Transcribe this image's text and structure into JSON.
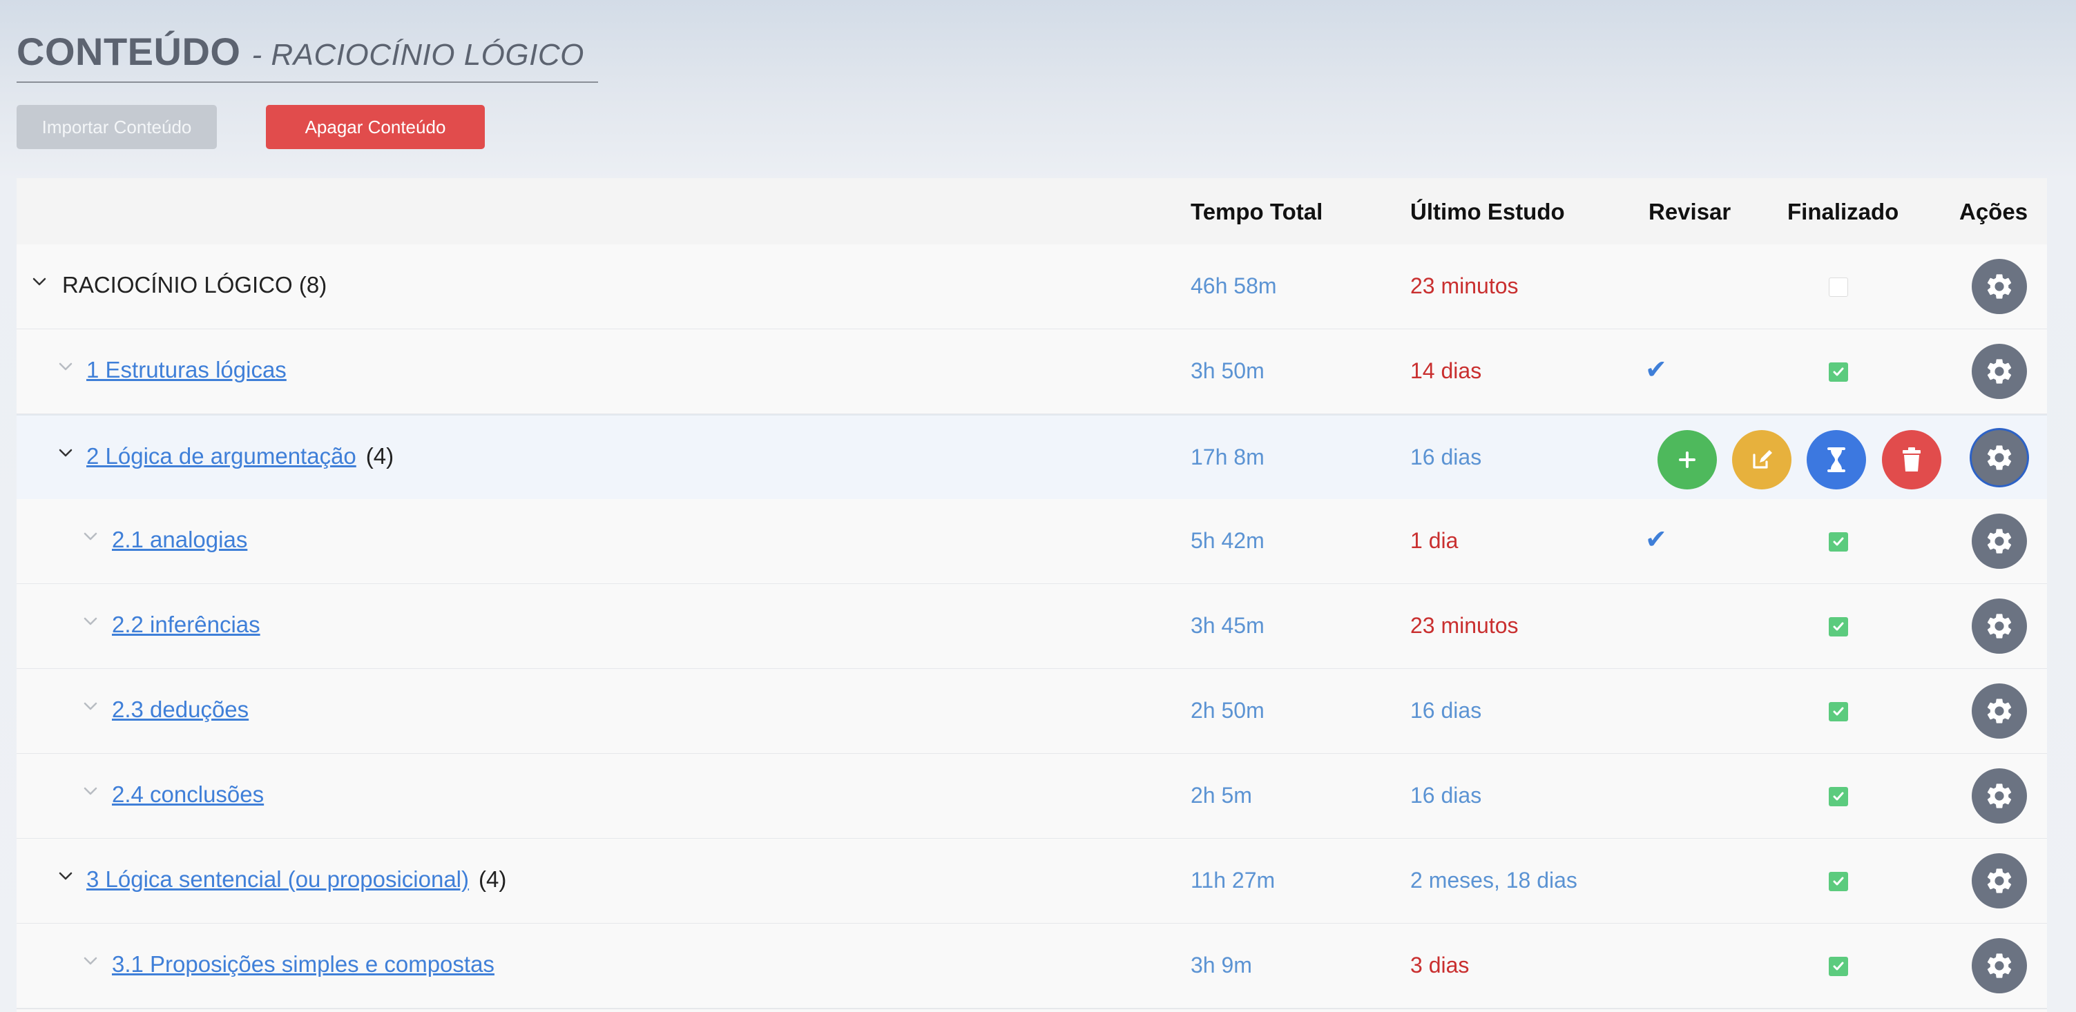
{
  "header": {
    "title": "CONTEÚDO",
    "subtitle": "- RACIOCÍNIO LÓGICO"
  },
  "buttons": {
    "import_label": "Importar Conteúdo",
    "delete_label": "Apagar Conteúdo"
  },
  "table": {
    "columns": {
      "total_time": "Tempo Total",
      "last_study": "Último Estudo",
      "review": "Revisar",
      "finished": "Finalizado",
      "actions": "Ações"
    },
    "rows": [
      {
        "name": "RACIOCÍNIO LÓGICO (8)",
        "count": "",
        "total": "46h 58m",
        "last": "23 minutos",
        "last_color": "red",
        "review": "",
        "finished": false
      },
      {
        "name": "1 Estruturas lógicas",
        "count": "",
        "total": "3h 50m",
        "last": "14 dias",
        "last_color": "red",
        "review": "✔",
        "finished": true
      },
      {
        "name": "2 Lógica de argumentação",
        "count": "(4)",
        "total": "17h 8m",
        "last": "16 dias",
        "last_color": "blue",
        "review": "",
        "finished": true
      },
      {
        "name": "2.1 analogias",
        "count": "",
        "total": "5h 42m",
        "last": "1 dia",
        "last_color": "red",
        "review": "✔",
        "finished": true
      },
      {
        "name": "2.2 inferências",
        "count": "",
        "total": "3h 45m",
        "last": "23 minutos",
        "last_color": "red",
        "review": "",
        "finished": true
      },
      {
        "name": "2.3 deduções",
        "count": "",
        "total": "2h 50m",
        "last": "16 dias",
        "last_color": "blue",
        "review": "",
        "finished": true
      },
      {
        "name": "2.4 conclusões",
        "count": "",
        "total": "2h 5m",
        "last": "16 dias",
        "last_color": "blue",
        "review": "",
        "finished": true
      },
      {
        "name": "3 Lógica sentencial (ou proposicional)",
        "count": "(4)",
        "total": "11h 27m",
        "last": "2 meses, 18 dias",
        "last_color": "blue",
        "review": "",
        "finished": true
      },
      {
        "name": "3.1 Proposições simples e compostas",
        "count": "",
        "total": "3h 9m",
        "last": "3 dias",
        "last_color": "red",
        "review": "",
        "finished": true
      }
    ]
  },
  "colors": {
    "accent": "#3f7fd8",
    "danger": "#e14c4c",
    "success": "#5ccb7e",
    "warning": "#e7b13d",
    "time_blue": "#5b93d3",
    "time_red": "#c92f2f"
  },
  "icons": {
    "expand": "chevron-down-icon",
    "review": "check-icon",
    "actions": "gear-icon",
    "add": "plus-icon",
    "edit": "edit-icon",
    "timer": "hourglass-icon",
    "delete": "trash-icon"
  }
}
